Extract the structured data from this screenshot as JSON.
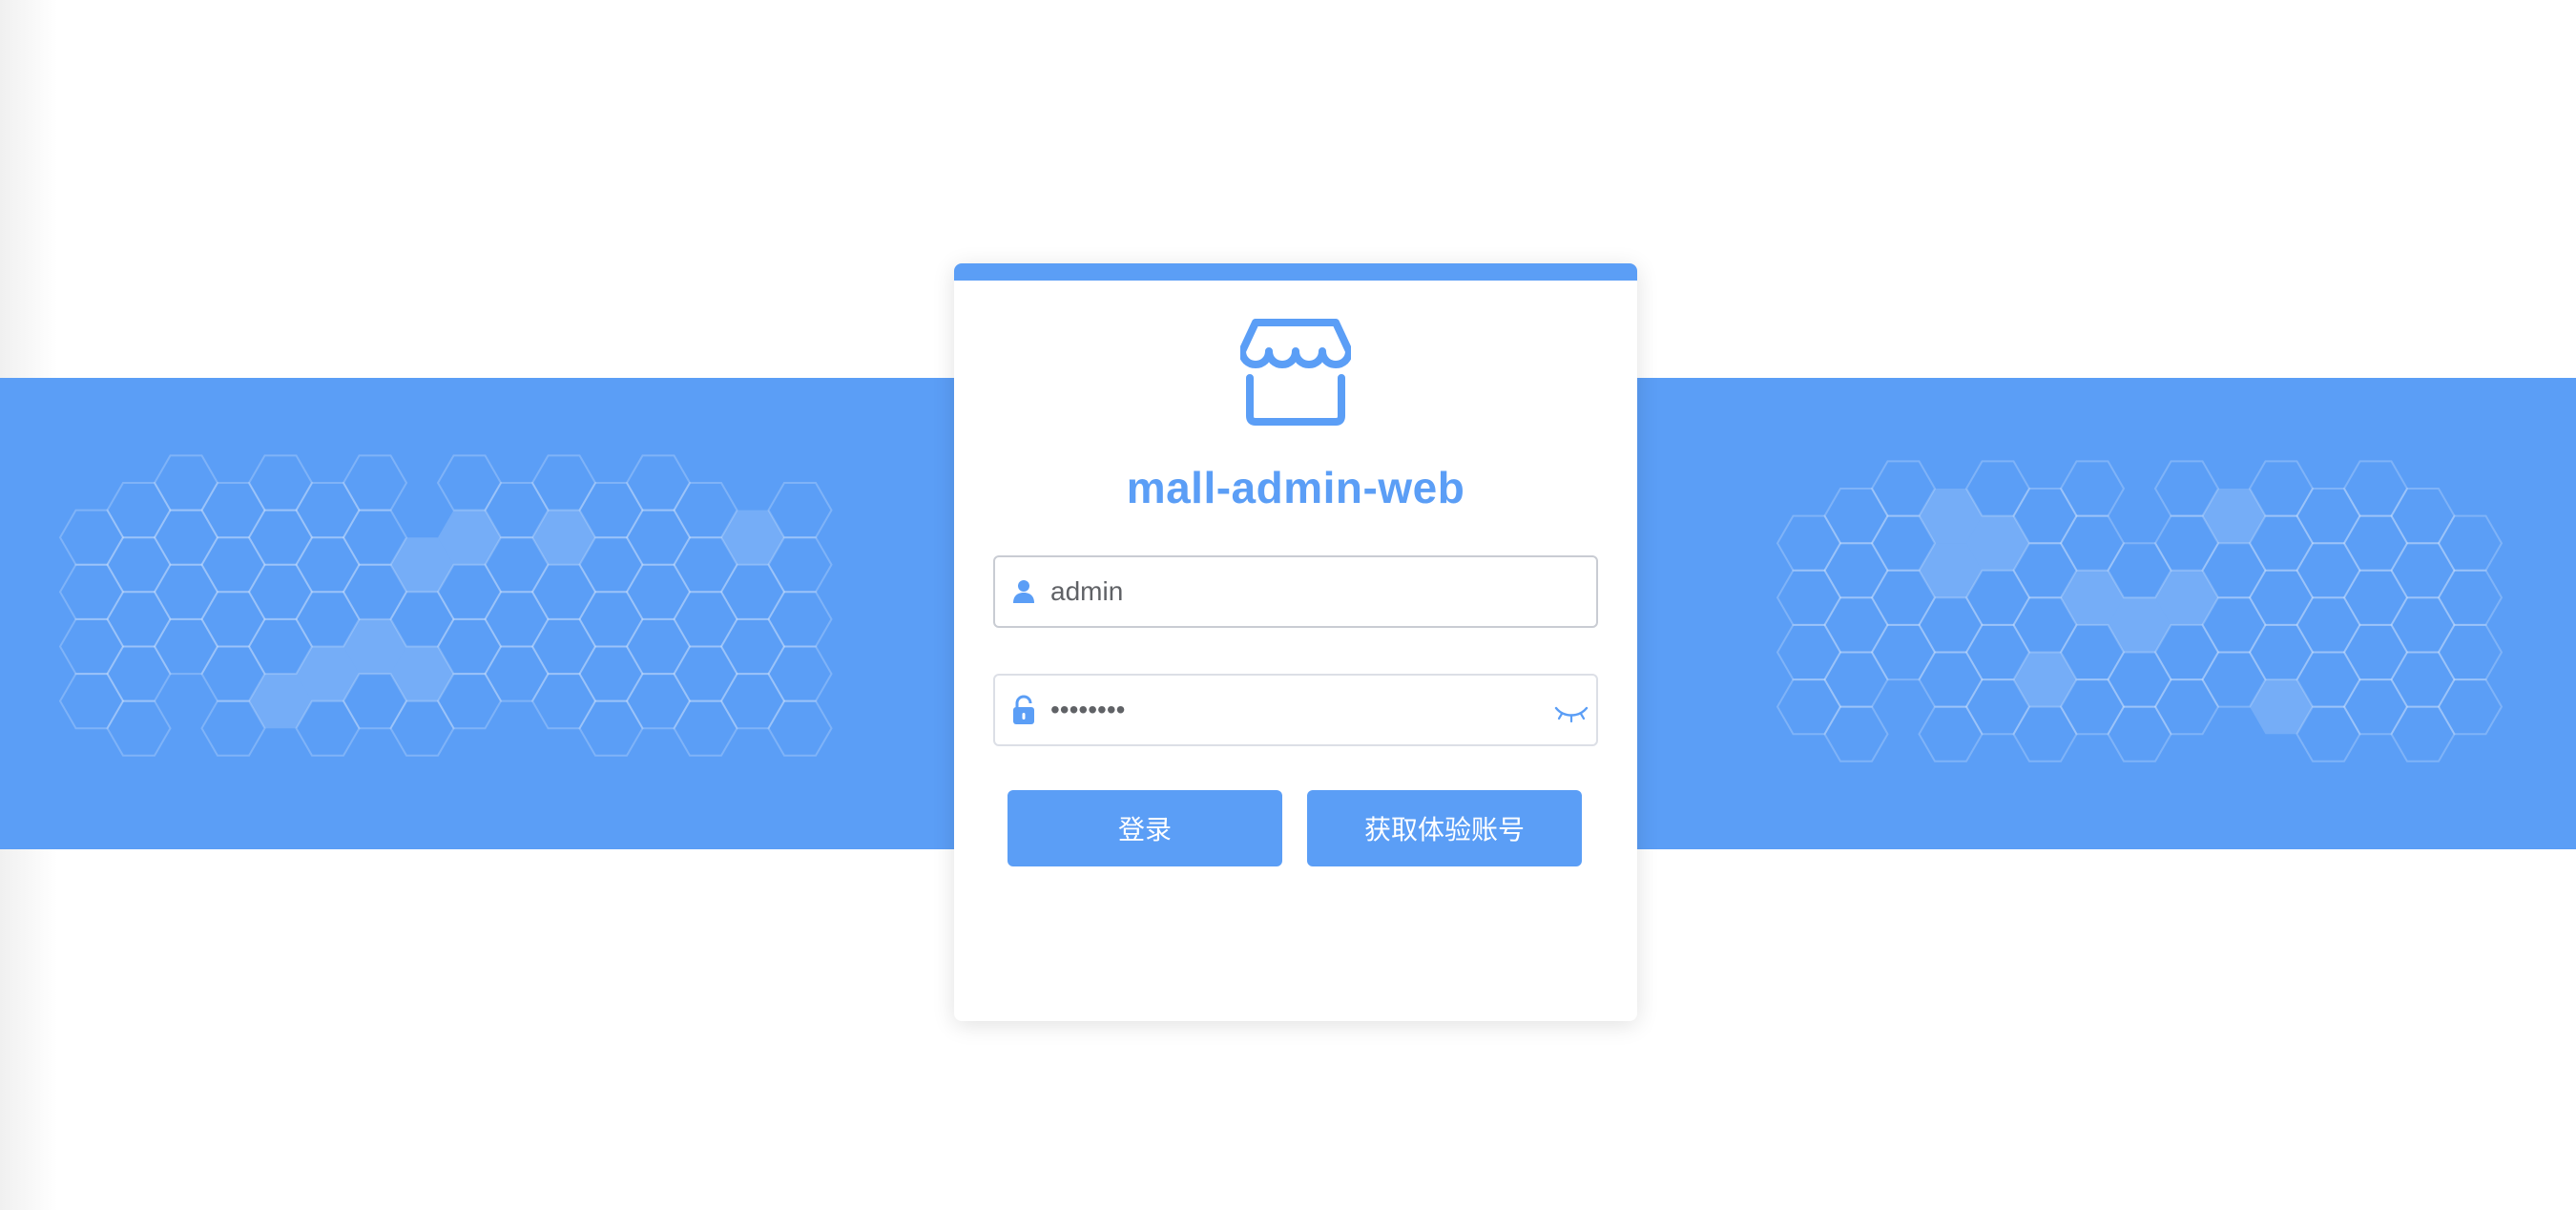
{
  "app": {
    "title": "mall-admin-web"
  },
  "login_form": {
    "username": {
      "value": "admin",
      "icon": "user-icon"
    },
    "password": {
      "value": "macro123",
      "icon": "lock-icon",
      "toggle_icon": "eye-closed-icon"
    },
    "login_button": "登录",
    "trial_account_button": "获取体验账号"
  },
  "colors": {
    "accent": "#5b9ef6",
    "border": "#c9ccd3",
    "text": "#606266"
  },
  "icons": {
    "logo": "storefront-icon"
  }
}
